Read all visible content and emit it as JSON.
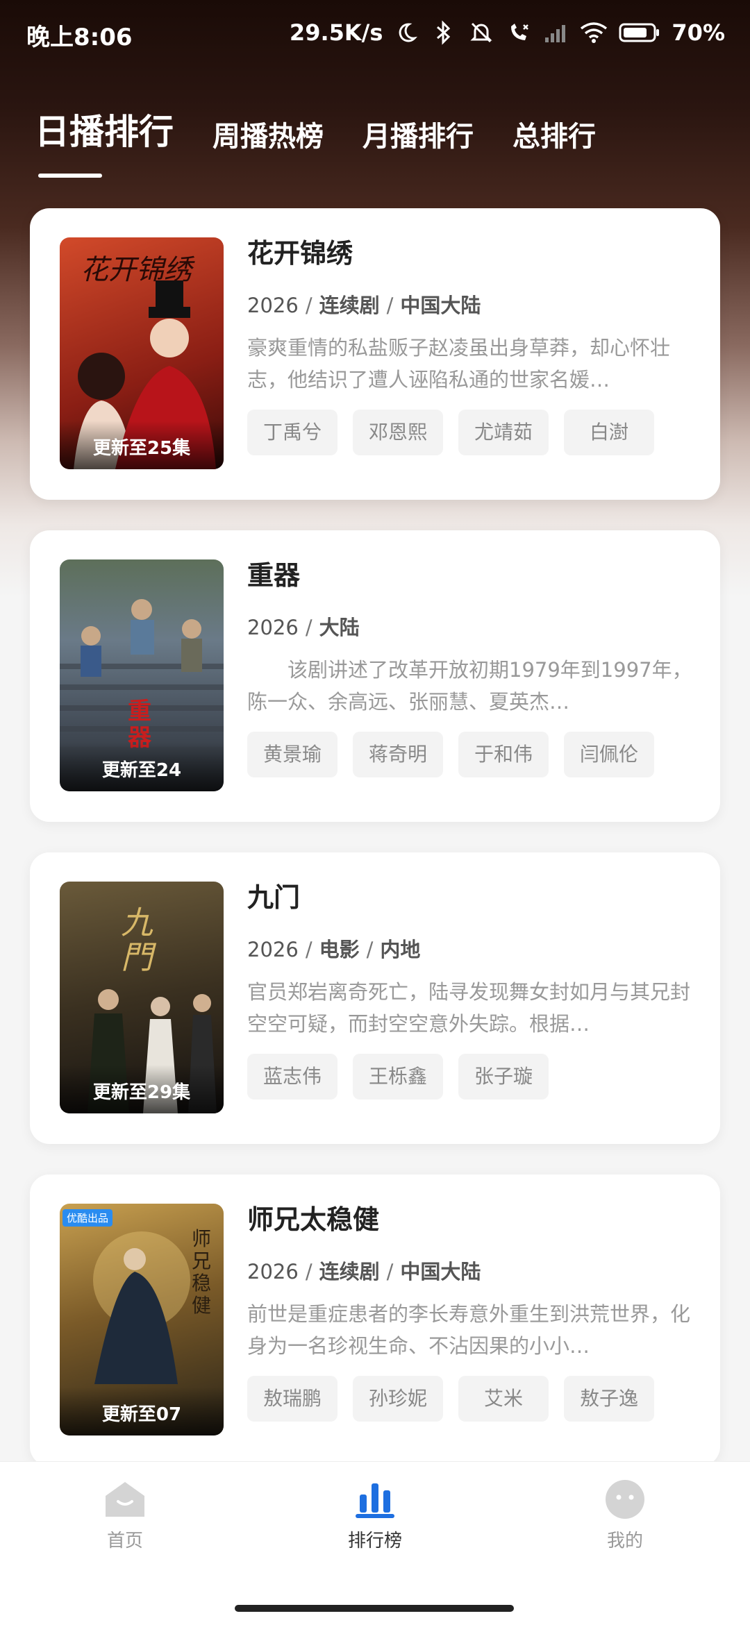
{
  "status_bar": {
    "time": "晚上8:06",
    "net_speed": "29.5K/s",
    "battery": "70%",
    "icons": [
      "moon-icon",
      "bluetooth-icon",
      "mute-icon",
      "call-icon",
      "signal-icon",
      "wifi-icon",
      "battery-icon"
    ]
  },
  "tabs": [
    "日播排行",
    "周播热榜",
    "月播排行",
    "总排行"
  ],
  "active_tab": "日播排行",
  "items": [
    {
      "title": "花开锦绣",
      "year": "2026",
      "meta_parts": [
        "连续剧",
        "中国大陆"
      ],
      "description": "豪爽重情的私盐贩子赵凌虽出身草莽，却心怀壮志，他结识了遭人诬陷私通的世家名媛…",
      "actors": [
        "丁禹兮",
        "邓恩熙",
        "尤靖茹",
        "白澍"
      ],
      "update_text": "更新至25集",
      "poster_colors": [
        "#c23b22",
        "#7a1a14"
      ]
    },
    {
      "title": "重器",
      "year": "2026",
      "meta_parts": [
        "大陆"
      ],
      "description": "　　该剧讲述了改革开放初期1979年到1997年，陈一众、余高远、张丽慧、夏英杰…",
      "actors": [
        "黄景瑜",
        "蒋奇明",
        "于和伟",
        "闫佩伦"
      ],
      "update_text": "更新至24",
      "poster_colors": [
        "#4a5a6a",
        "#2a3038"
      ]
    },
    {
      "title": "九门",
      "year": "2026",
      "meta_parts": [
        "电影",
        "内地"
      ],
      "description": "官员郑岩离奇死亡，陆寻发现舞女封如月与其兄封空空可疑，而封空空意外失踪。根据…",
      "actors": [
        "蓝志伟",
        "王栎鑫",
        "张子璇"
      ],
      "update_text": "更新至29集",
      "poster_colors": [
        "#5a4a30",
        "#1e1a14"
      ]
    },
    {
      "title": "师兄太稳健",
      "year": "2026",
      "meta_parts": [
        "连续剧",
        "中国大陆"
      ],
      "description": "前世是重症患者的李长寿意外重生到洪荒世界，化身为一名珍视生命、不沾因果的小小…",
      "actors": [
        "敖瑞鹏",
        "孙珍妮",
        "艾米",
        "敖子逸"
      ],
      "update_text": "更新至07",
      "poster_tag": "优酷出品",
      "poster_colors": [
        "#b08a40",
        "#3a3020"
      ]
    }
  ],
  "bottom_nav": [
    {
      "label": "首页",
      "icon": "home-icon"
    },
    {
      "label": "排行榜",
      "icon": "ranking-icon"
    },
    {
      "label": "我的",
      "icon": "profile-icon"
    }
  ],
  "active_nav": "排行榜",
  "accent_color": "#1e6fe0"
}
